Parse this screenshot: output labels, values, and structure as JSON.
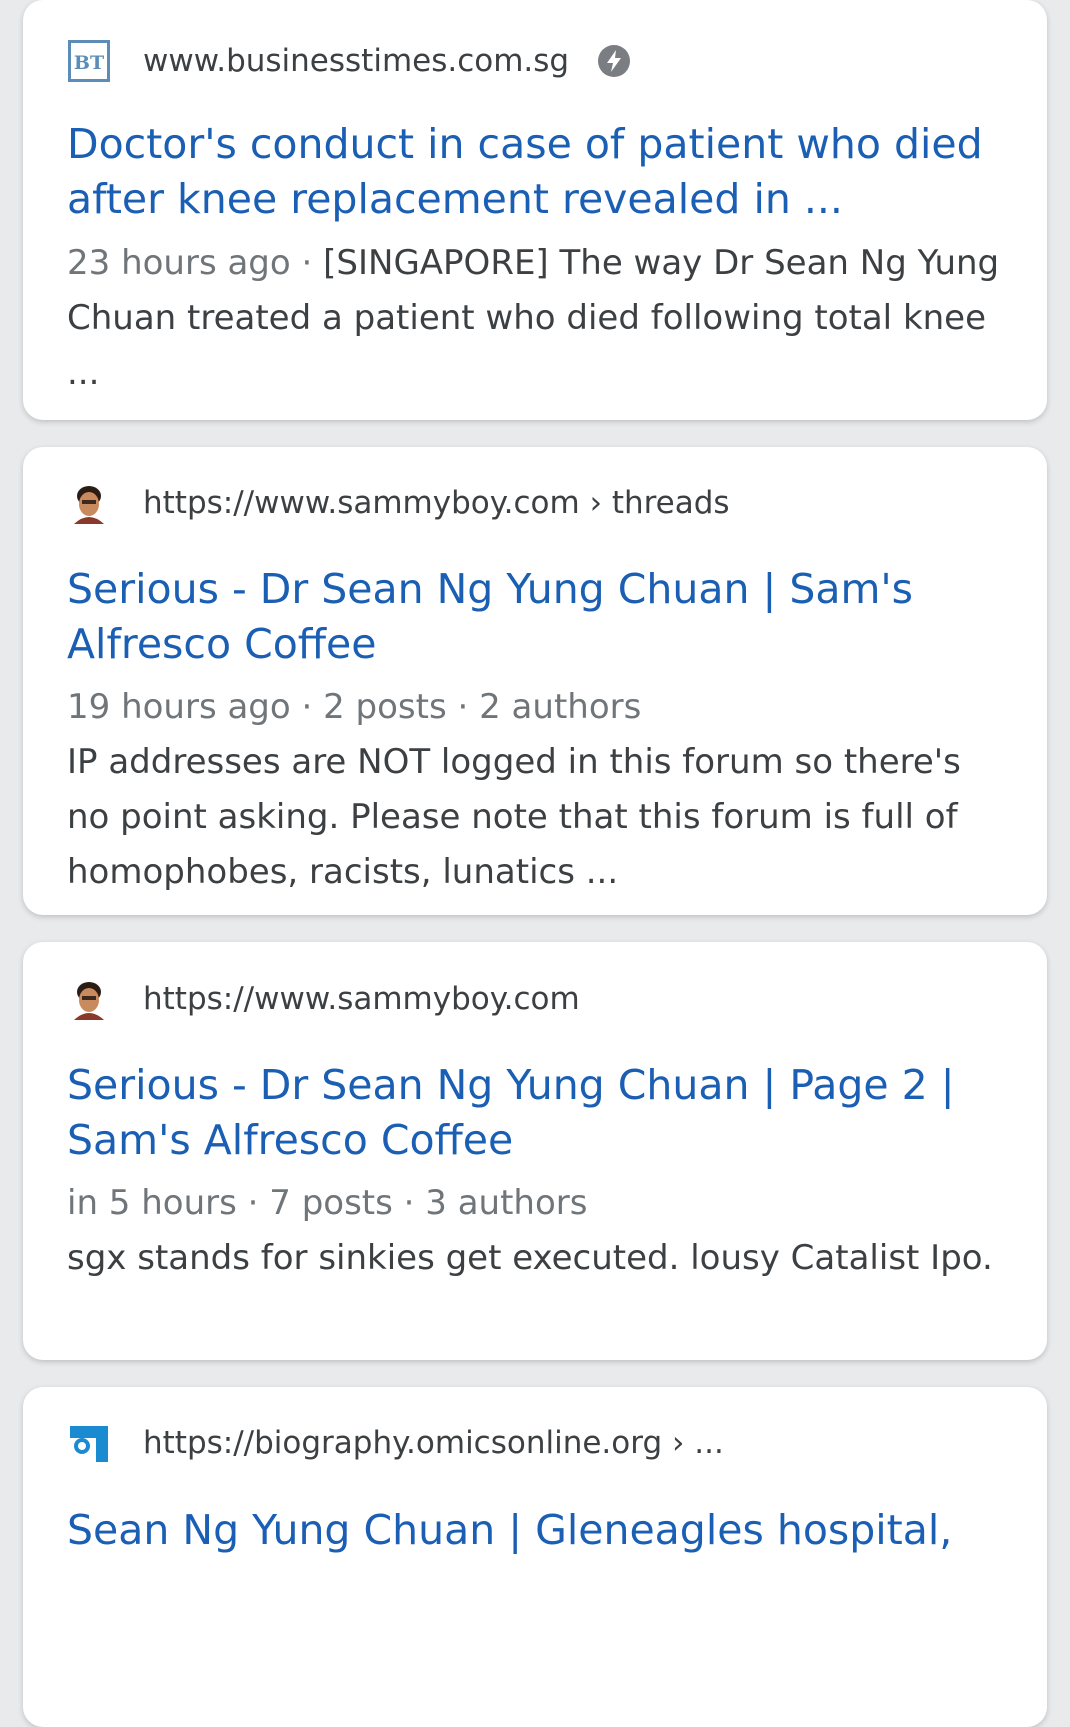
{
  "results": [
    {
      "favicon": "bt-logo-icon",
      "favicon_text": "BT",
      "url": "www.businesstimes.com.sg",
      "amp_icon": "amp-bolt-icon",
      "title_line1": "Doctor's conduct in case of patient who died",
      "title_line2": "after knee replacement revealed in ...",
      "meta": "23 hours ago",
      "sep": " · ",
      "snippet": "[SINGAPORE] The way Dr Sean Ng Yung Chuan treated a patient who died following total knee ..."
    },
    {
      "favicon": "sammyboy-avatar-icon",
      "url": "https://www.sammyboy.com › threads",
      "title_line1": "Serious - Dr Sean Ng Yung Chuan | Sam's",
      "title_line2": "Alfresco Coffee",
      "meta": "19 hours ago · 2 posts · 2 authors",
      "snippet": "IP addresses are NOT logged in this forum so there's no point asking. Please note that this forum is full of homophobes, racists, lunatics ..."
    },
    {
      "favicon": "sammyboy-avatar-icon",
      "url": "https://www.sammyboy.com",
      "title_line1": "Serious - Dr Sean Ng Yung Chuan | Page 2 |",
      "title_line2": "Sam's Alfresco Coffee",
      "meta": "in 5 hours · 7 posts · 3 authors",
      "snippet": "sgx stands for sinkies get executed. lousy Catalist Ipo."
    },
    {
      "favicon": "omics-logo-icon",
      "url": "https://biography.omicsonline.org › ...",
      "title_line1": "Sean Ng Yung Chuan | Gleneagles hospital,"
    }
  ],
  "colors": {
    "title": "#1a5fb4",
    "text": "#3c4043",
    "meta": "#70757a",
    "background": "#e9eaec"
  }
}
